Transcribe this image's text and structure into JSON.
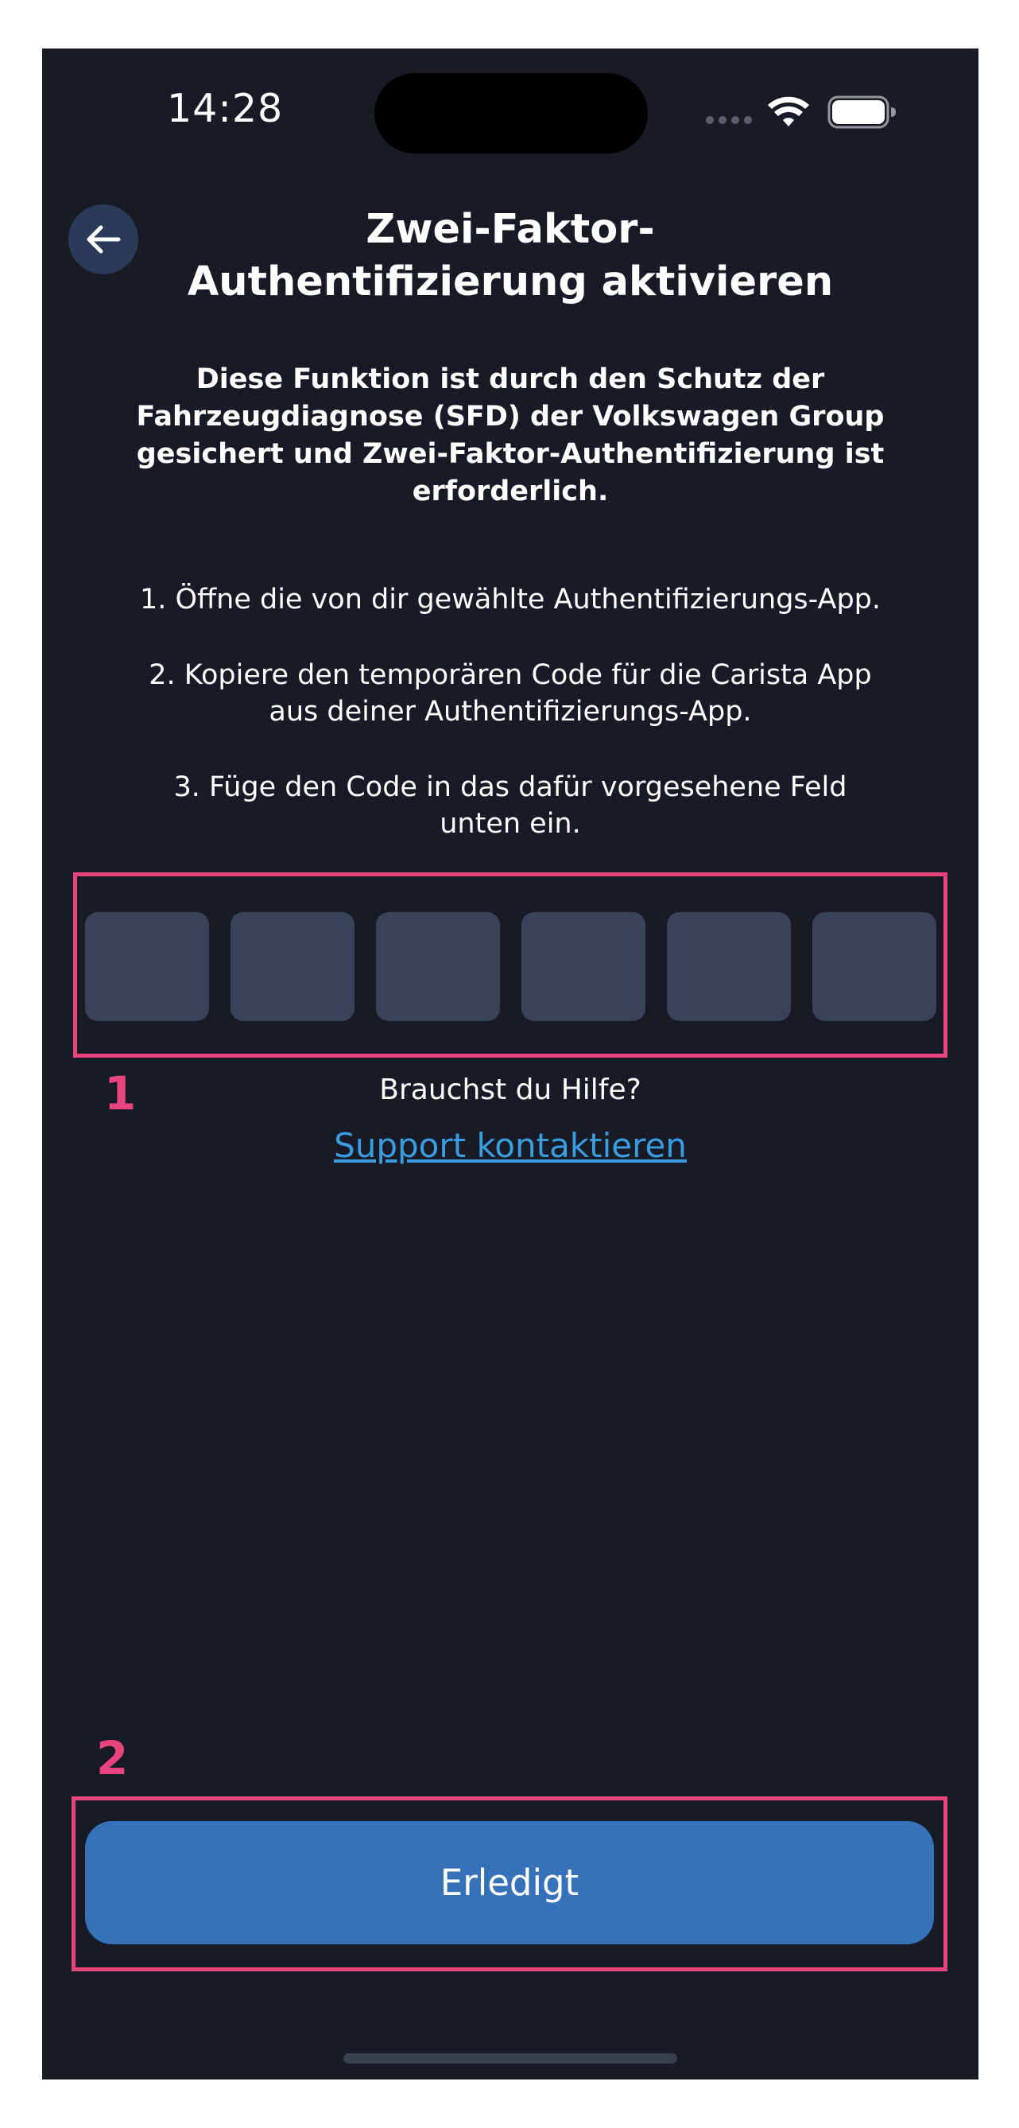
{
  "status_bar": {
    "time": "14:28",
    "icons": [
      "cellular-signal-icon",
      "wifi-icon",
      "battery-icon"
    ]
  },
  "header": {
    "back_icon": "arrow-left-icon",
    "title_line1": "Zwei-Faktor-",
    "title_line2": "Authentifizierung aktivieren"
  },
  "notice": {
    "line1": "Diese Funktion ist durch den Schutz der",
    "line2": "Fahrzeugdiagnose (SFD) der Volkswagen Group",
    "line3": "gesichert und Zwei-Faktor-Authentifizierung ist",
    "line4": "erforderlich."
  },
  "steps": [
    {
      "line1": "1. Öffne die von dir gewählte Authentifizierungs-App.",
      "line2": ""
    },
    {
      "line1": "2. Kopiere den temporären Code für die Carista App",
      "line2": "aus deiner Authentifizierungs-App."
    },
    {
      "line1": "3. Füge den Code in das dafür vorgesehene Feld",
      "line2": "unten ein."
    }
  ],
  "code_input": {
    "digits": [
      "",
      "",
      "",
      "",
      "",
      ""
    ]
  },
  "help": {
    "question": "Brauchst du Hilfe?",
    "link": "Support kontaktieren"
  },
  "actions": {
    "done_label": "Erledigt"
  },
  "annotations": {
    "marker_1": "1",
    "marker_2": "2"
  },
  "colors": {
    "background": "#181b25",
    "code_box": "#394259",
    "primary_button": "#3572b9",
    "link": "#3a9de0",
    "highlight": "#e8457f",
    "back_button": "#2b3a57"
  }
}
